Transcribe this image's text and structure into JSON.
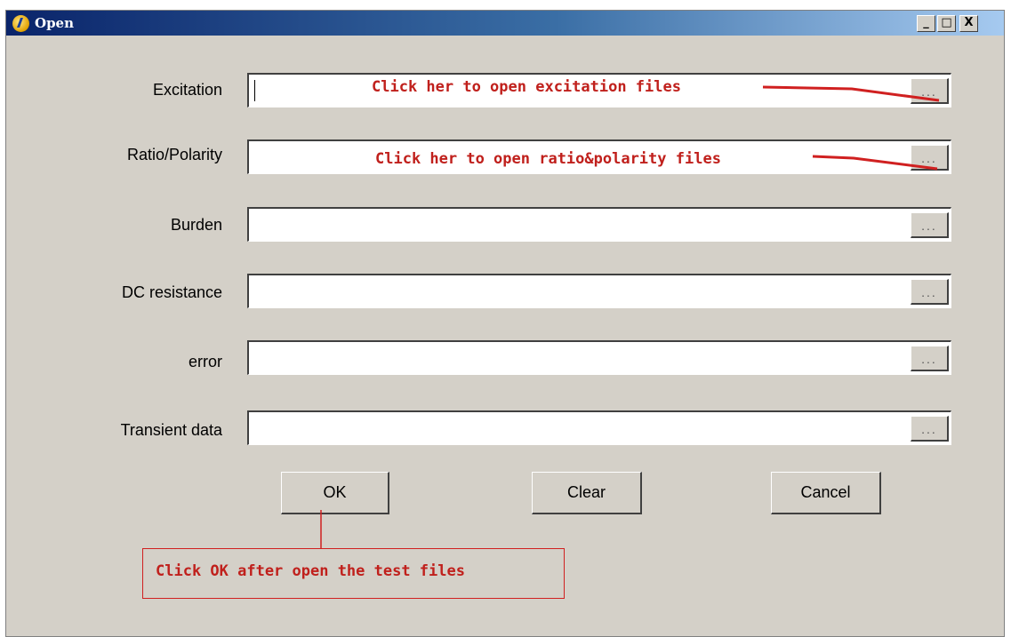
{
  "window": {
    "title": "Open",
    "minimize": "_",
    "maximize": "□",
    "close": "X"
  },
  "fields": [
    {
      "label": "Excitation",
      "value": "",
      "browse": "..."
    },
    {
      "label": "Ratio/Polarity",
      "value": "",
      "browse": "..."
    },
    {
      "label": "Burden",
      "value": "",
      "browse": "..."
    },
    {
      "label": "DC resistance",
      "value": "",
      "browse": "..."
    },
    {
      "label": "error",
      "value": "",
      "browse": "..."
    },
    {
      "label": "Transient data",
      "value": "",
      "browse": "..."
    }
  ],
  "buttons": {
    "ok": "OK",
    "clear": "Clear",
    "cancel": "Cancel"
  },
  "annotations": {
    "excitation": "Click her to open excitation files",
    "ratio": "Click her to open ratio&polarity files",
    "ok": "Click OK after open the test files"
  },
  "colors": {
    "annotation": "#c0201c",
    "dialog_bg": "#d4d0c8"
  }
}
